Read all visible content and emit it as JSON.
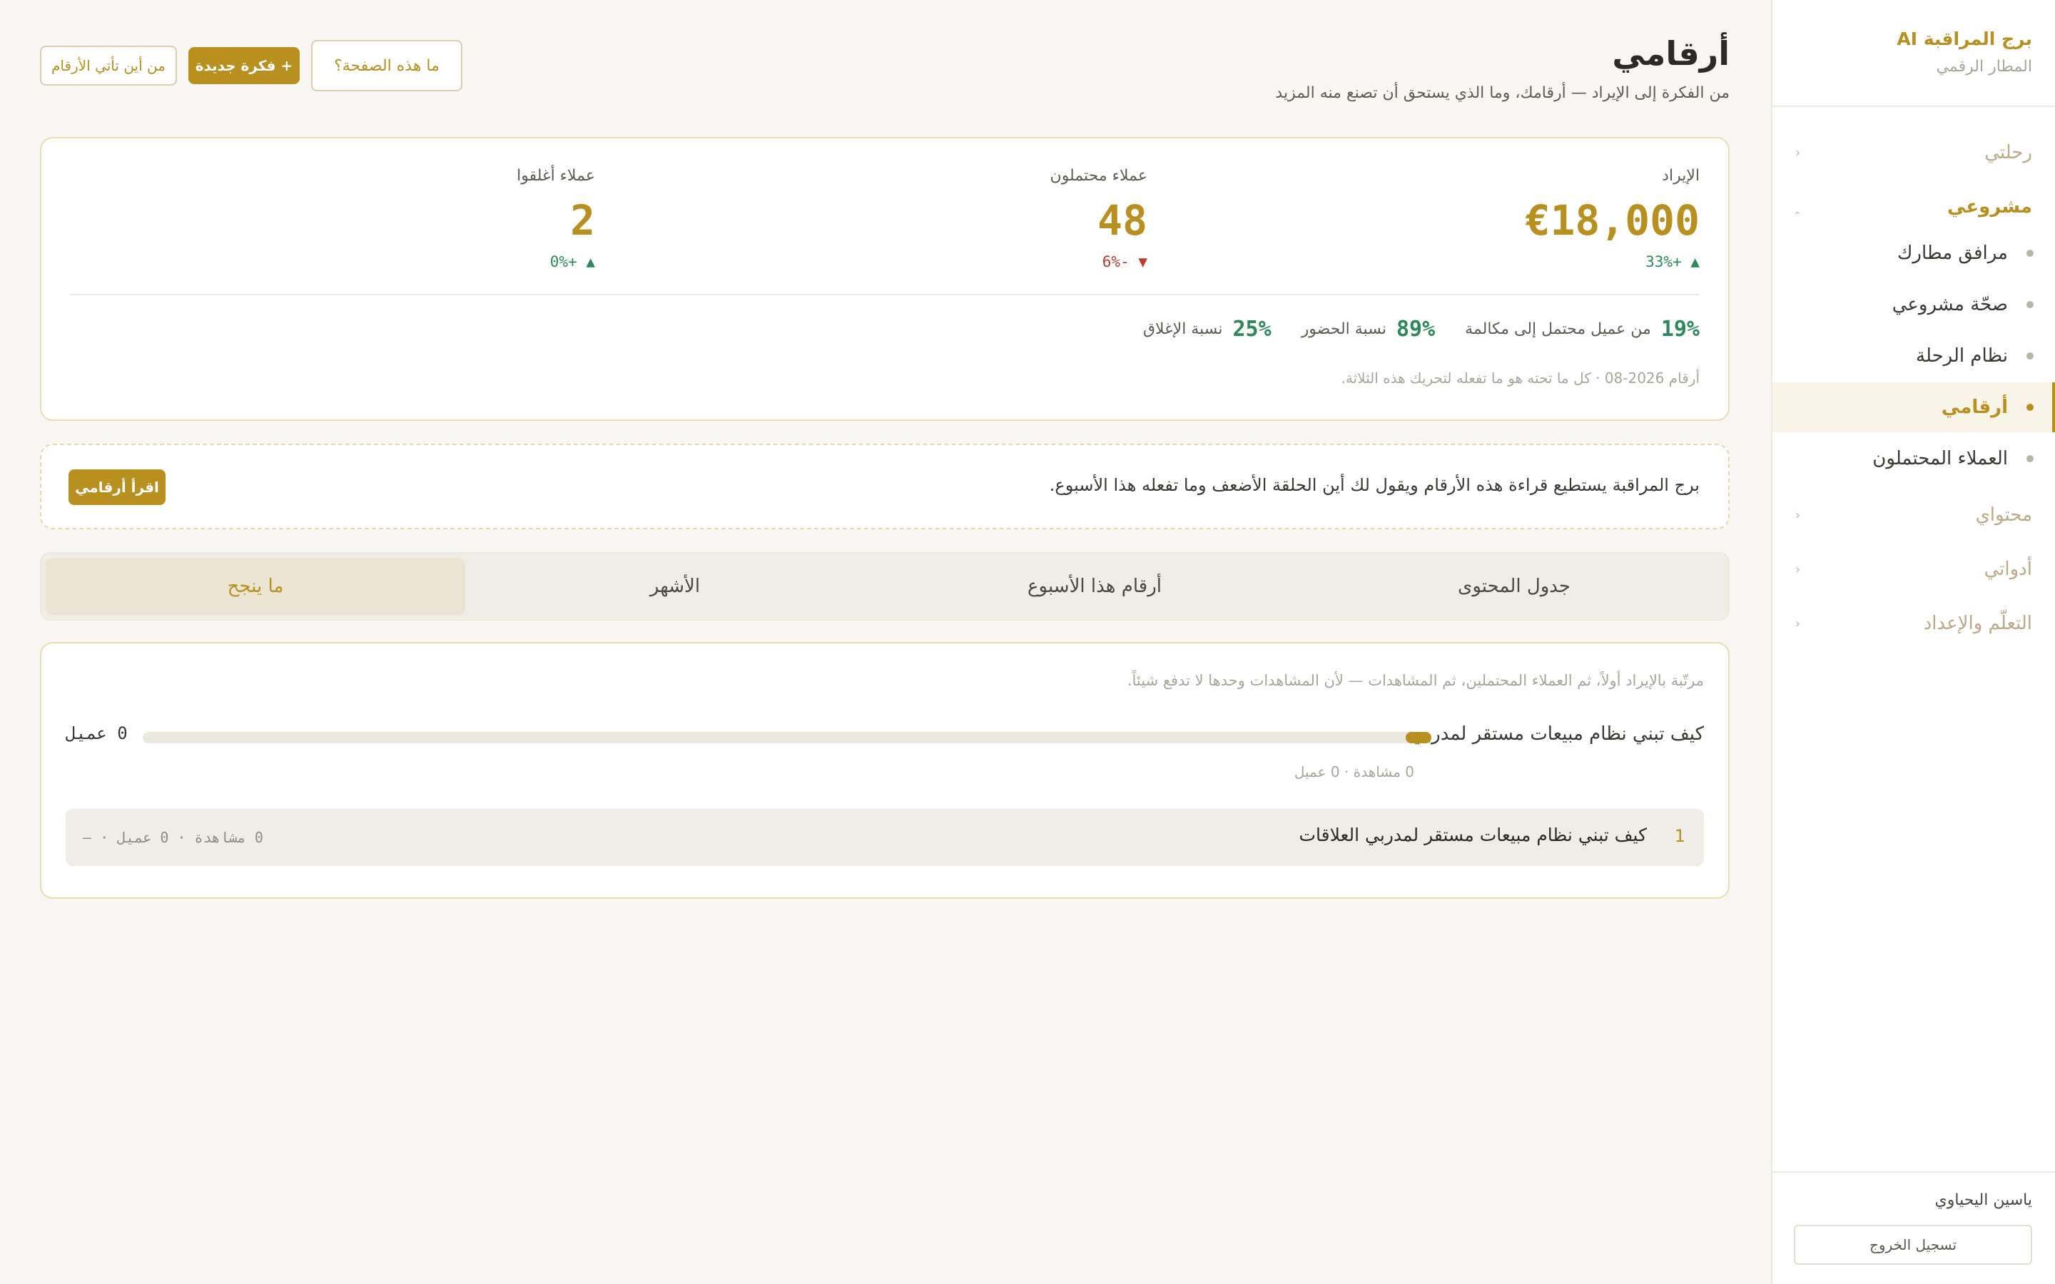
{
  "sidebar": {
    "brand_title": "برج المراقبة AI",
    "brand_sub": "المطار الرقمي",
    "groups": [
      {
        "label": "رحلتي",
        "chevron": "‹"
      },
      {
        "label": "مشروعي",
        "chevron": "‸"
      },
      {
        "label": "محتواي",
        "chevron": "‹"
      },
      {
        "label": "أدواتي",
        "chevron": "‹"
      },
      {
        "label": "التعلّم والإعداد",
        "chevron": "‹"
      }
    ],
    "project_items": [
      {
        "label": "مرافق مطارك"
      },
      {
        "label": "صحّة مشروعي"
      },
      {
        "label": "نظام الرحلة"
      },
      {
        "label": "أرقامي"
      },
      {
        "label": "العملاء المحتملون"
      }
    ],
    "user_name": "ياسين اليحياوي",
    "logout_label": "تسجيل الخروج"
  },
  "header": {
    "title": "أرقامي",
    "subtitle": "من الفكرة إلى الإيراد — أرقامك، وما الذي يستحق أن تصنع منه المزيد",
    "help_button": "ما هذه الصفحة؟",
    "new_idea_button": "+ فكرة جديدة",
    "source_button": "من أين تأتي الأرقام"
  },
  "stats": {
    "metrics": [
      {
        "label": "الإيراد",
        "value": "€18,000",
        "delta": "▲ +33%",
        "direction": "up"
      },
      {
        "label": "عملاء محتملون",
        "value": "48",
        "delta": "▼ -6%",
        "direction": "down"
      },
      {
        "label": "عملاء أغلقوا",
        "value": "2",
        "delta": "▲ +0%",
        "direction": "up"
      }
    ],
    "ratios": [
      {
        "value": "19%",
        "label": "من عميل محتمل إلى مكالمة"
      },
      {
        "value": "89%",
        "label": "نسبة الحضور"
      },
      {
        "value": "25%",
        "label": "نسبة الإغلاق"
      }
    ],
    "note": "أرقام 2026-08 · كل ما تحته هو ما تفعله لتحريك هذه الثلاثة."
  },
  "advisor": {
    "text": "برج المراقبة يستطيع قراءة هذه الأرقام ويقول لك أين الحلقة الأضعف وما تفعله هذا الأسبوع.",
    "button": "اقرأ أرقامي"
  },
  "tabs": [
    {
      "label": "جدول المحتوى",
      "active": false
    },
    {
      "label": "أرقام هذا الأسبوع",
      "active": false
    },
    {
      "label": "الأشهر",
      "active": false
    },
    {
      "label": "ما ينجح",
      "active": true
    }
  ],
  "content": {
    "note": "مرتّبة بالإيراد أولاً، ثم العملاء المحتملين، ثم المشاهدات — لأن المشاهدات وحدها لا تدفع شيئاً.",
    "bar": {
      "title": "كيف تبني نظام مبيعات مستقر لمدربي",
      "count": "0 عميل",
      "fill_fraction": 0,
      "meta": "0 مشاهدة · 0 عميل"
    },
    "list_item": {
      "number": "1",
      "title": "كيف تبني نظام مبيعات مستقر لمدربي العلاقات",
      "meta": "0 مشاهدة · 0 عميل · —"
    }
  },
  "colors": {
    "accent": "#b8901f",
    "positive": "#2c8a5a",
    "negative": "#c0392b"
  }
}
